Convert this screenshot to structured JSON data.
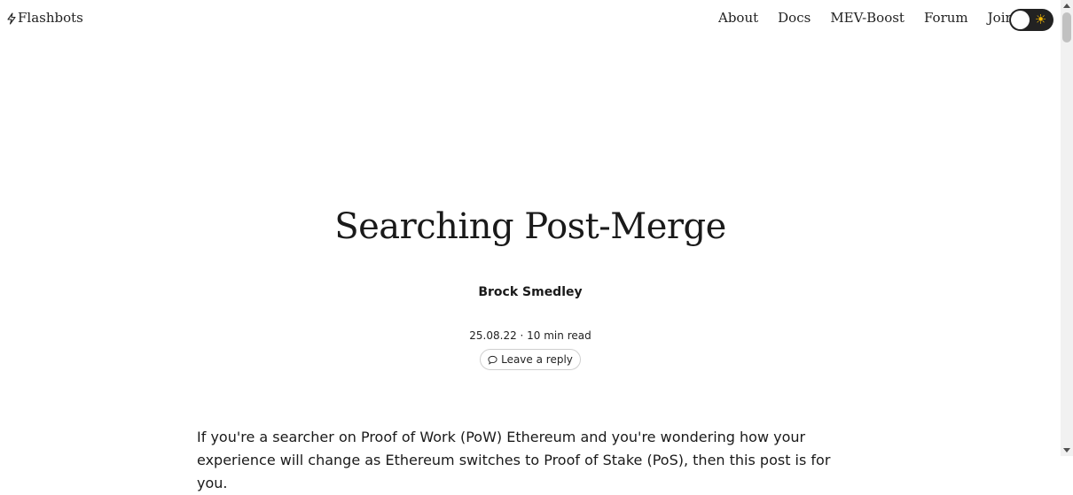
{
  "nav": {
    "brand": "Flashbots",
    "links": [
      "About",
      "Docs",
      "MEV-Boost",
      "Forum",
      "Join us"
    ]
  },
  "theme_toggle": {
    "icon": "sun-icon",
    "state": "light"
  },
  "post": {
    "title": "Searching Post-Merge",
    "author": "Brock Smedley",
    "meta": "25.08.22 · 10 min read",
    "reply_label": "Leave a reply",
    "intro": "If you're a searcher on Proof of Work (PoW) Ethereum and you're wondering how your experience will change as Ethereum switches to Proof of Stake (PoS), then this post is for you."
  },
  "colors": {
    "text": "#1a1a1a",
    "toggle_bg": "#222222",
    "sun": "#f5b800"
  }
}
